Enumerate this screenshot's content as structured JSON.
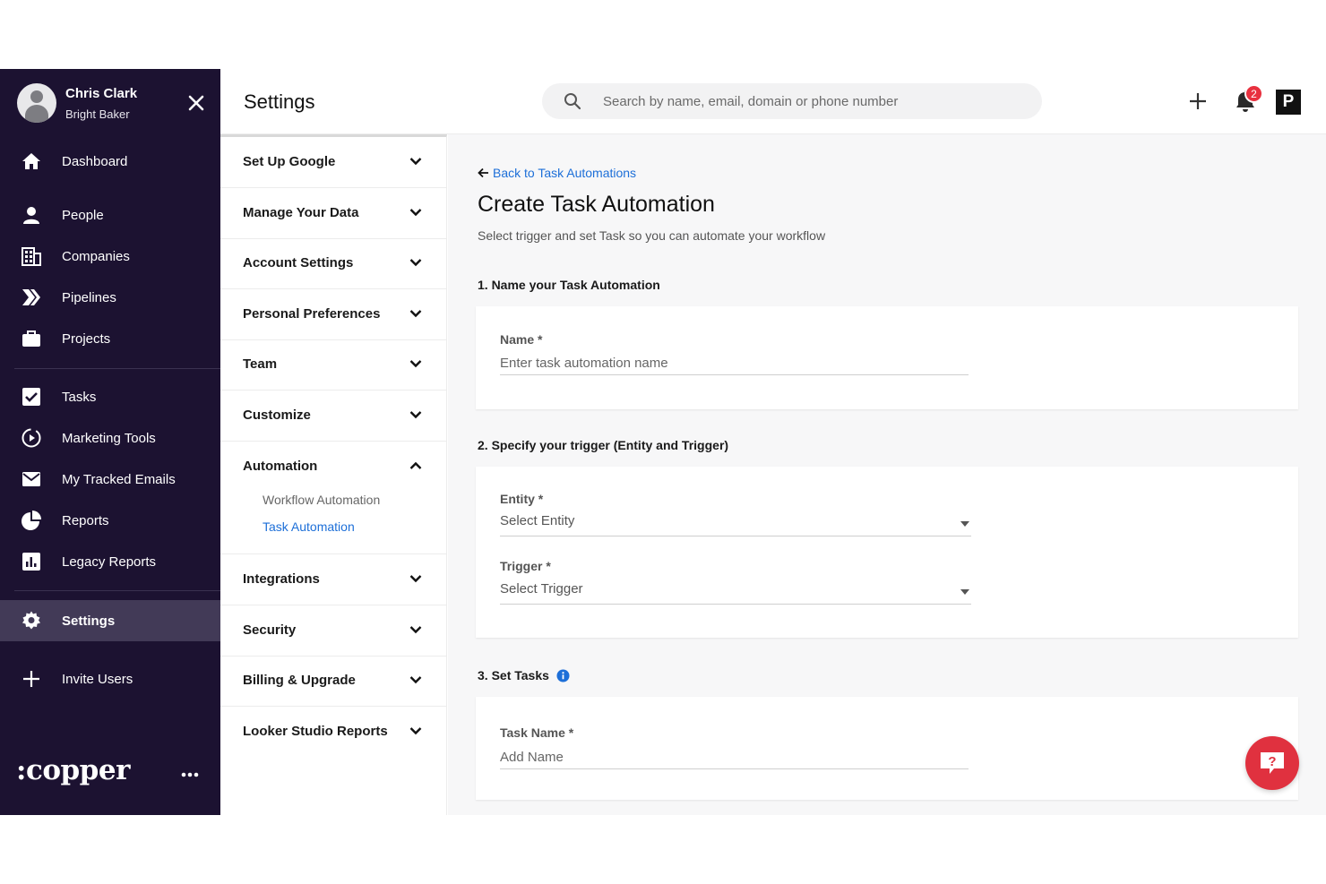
{
  "user": {
    "name": "Chris Clark",
    "company": "Bright Baker"
  },
  "nav": {
    "items": [
      {
        "label": "Dashboard",
        "icon": "home-icon"
      },
      {
        "label": "People",
        "icon": "person-icon"
      },
      {
        "label": "Companies",
        "icon": "building-icon"
      },
      {
        "label": "Pipelines",
        "icon": "pipelines-icon"
      },
      {
        "label": "Projects",
        "icon": "briefcase-icon"
      },
      {
        "label": "Tasks",
        "icon": "checkbox-icon"
      },
      {
        "label": "Marketing Tools",
        "icon": "marketing-icon"
      },
      {
        "label": "My Tracked Emails",
        "icon": "mail-icon"
      },
      {
        "label": "Reports",
        "icon": "pie-chart-icon"
      },
      {
        "label": "Legacy Reports",
        "icon": "bar-chart-icon"
      },
      {
        "label": "Settings",
        "icon": "gear-icon"
      },
      {
        "label": "Invite Users",
        "icon": "plus-icon"
      }
    ],
    "active": "Settings",
    "logo": ":copper"
  },
  "header": {
    "title": "Settings",
    "search_placeholder": "Search by name, email, domain or phone number",
    "notification_count": "2",
    "profile_letter": "P"
  },
  "settings_nav": {
    "items": [
      "Set Up Google",
      "Manage Your Data",
      "Account Settings",
      "Personal Preferences",
      "Team",
      "Customize",
      "Automation",
      "Integrations",
      "Security",
      "Billing & Upgrade",
      "Looker Studio Reports"
    ],
    "automation_sub": [
      "Workflow Automation",
      "Task Automation"
    ],
    "active_sub": "Task Automation"
  },
  "form": {
    "back_label": "Back to Task Automations",
    "title": "Create Task Automation",
    "subtitle": "Select trigger and set Task so you can automate your workflow",
    "section1": "1. Name your Task Automation",
    "name_label": "Name *",
    "name_placeholder": "Enter task automation name",
    "section2": "2. Specify your trigger (Entity and Trigger)",
    "entity_label": "Entity *",
    "entity_value": "Select Entity",
    "trigger_label": "Trigger *",
    "trigger_value": "Select Trigger",
    "section3": "3. Set Tasks",
    "task_name_label": "Task Name *",
    "task_name_placeholder": "Add Name"
  },
  "colors": {
    "nav_bg": "#1c1231",
    "nav_active": "#423a57",
    "accent": "#1d6fd8",
    "help": "#e0313f"
  }
}
